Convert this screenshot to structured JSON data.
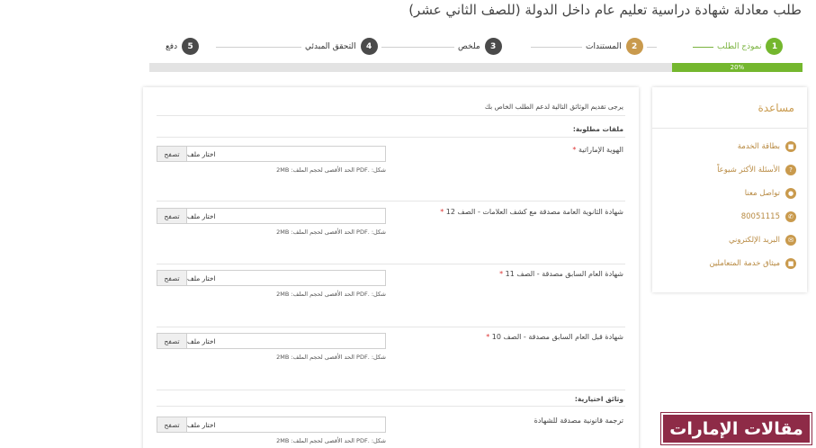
{
  "page": {
    "title": "طلب معادلة شهادة دراسية تعليم عام داخل الدولة (للصف الثاني عشر)"
  },
  "stepper": {
    "steps": [
      {
        "number": "1",
        "label": "نموذج الطلب",
        "color": "#74b72e",
        "status": "active"
      },
      {
        "number": "2",
        "label": "المستندات",
        "color": "#c99a4d",
        "status": "pending"
      },
      {
        "number": "3",
        "label": "ملخص",
        "color": "#4a4a4a",
        "status": "pending"
      },
      {
        "number": "4",
        "label": "التحقق المبدئي",
        "color": "#4a4a4a",
        "status": "pending"
      },
      {
        "number": "5",
        "label": "دفع",
        "color": "#4a4a4a",
        "status": "pending"
      }
    ],
    "progress_percent": 20,
    "progress_text": "20%"
  },
  "help": {
    "title": "مساعدة",
    "items": [
      {
        "label": "بطاقة الخدمة",
        "icon": "document-icon",
        "glyph": "■"
      },
      {
        "label": "الأسئلة الأكثر شيوعاً",
        "icon": "question-icon",
        "glyph": "?"
      },
      {
        "label": "تواصل معنا",
        "icon": "location-pin-icon",
        "glyph": "●"
      },
      {
        "label": "80051115",
        "icon": "phone-icon",
        "glyph": "✆"
      },
      {
        "label": "البريد الإلكتروني",
        "icon": "email-icon",
        "glyph": "✉"
      },
      {
        "label": "ميثاق خدمة المتعاملين",
        "icon": "charter-icon",
        "glyph": "■"
      }
    ]
  },
  "form": {
    "intro": "يرجى تقديم الوثائق التالية لدعم الطلب الخاص بك",
    "required_heading": "ملفات مطلوبة:",
    "optional_heading": "وثائق اختيارية:",
    "browse_label": "تصفح",
    "file_placeholder": "اختار ملف",
    "hint": "شكل: .PDF الحد الأقصى لحجم الملف: 2MB",
    "required_mark": "*",
    "required_docs": [
      {
        "label": "الهوية الإماراتية"
      },
      {
        "label": "شهادة الثانوية العامة مصدقة مع كشف العلامات - الصف 12"
      },
      {
        "label": "شهادة العام السابق مصدقة - الصف 11"
      },
      {
        "label": "شهادة قبل العام السابق مصدقة - الصف 10"
      }
    ],
    "optional_docs": [
      {
        "label": "ترجمة قانونية مصدقة للشهادة"
      }
    ]
  },
  "watermark": {
    "text": "مقالات الإمارات"
  }
}
